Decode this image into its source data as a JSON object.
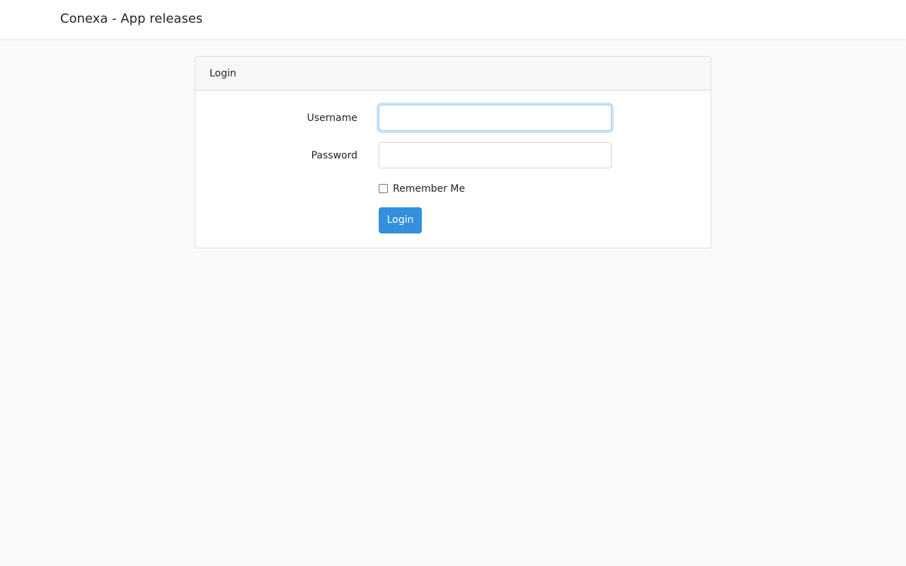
{
  "navbar": {
    "brand": "Conexa - App releases"
  },
  "login_card": {
    "header": "Login",
    "username": {
      "label": "Username",
      "value": "",
      "placeholder": ""
    },
    "password": {
      "label": "Password",
      "value": "",
      "placeholder": ""
    },
    "remember_me": {
      "label": "Remember Me",
      "checked": false
    },
    "submit_label": "Login"
  },
  "colors": {
    "page_background": "#f8fafc",
    "primary": "#3490dc",
    "focus_border": "#a1cbef"
  }
}
